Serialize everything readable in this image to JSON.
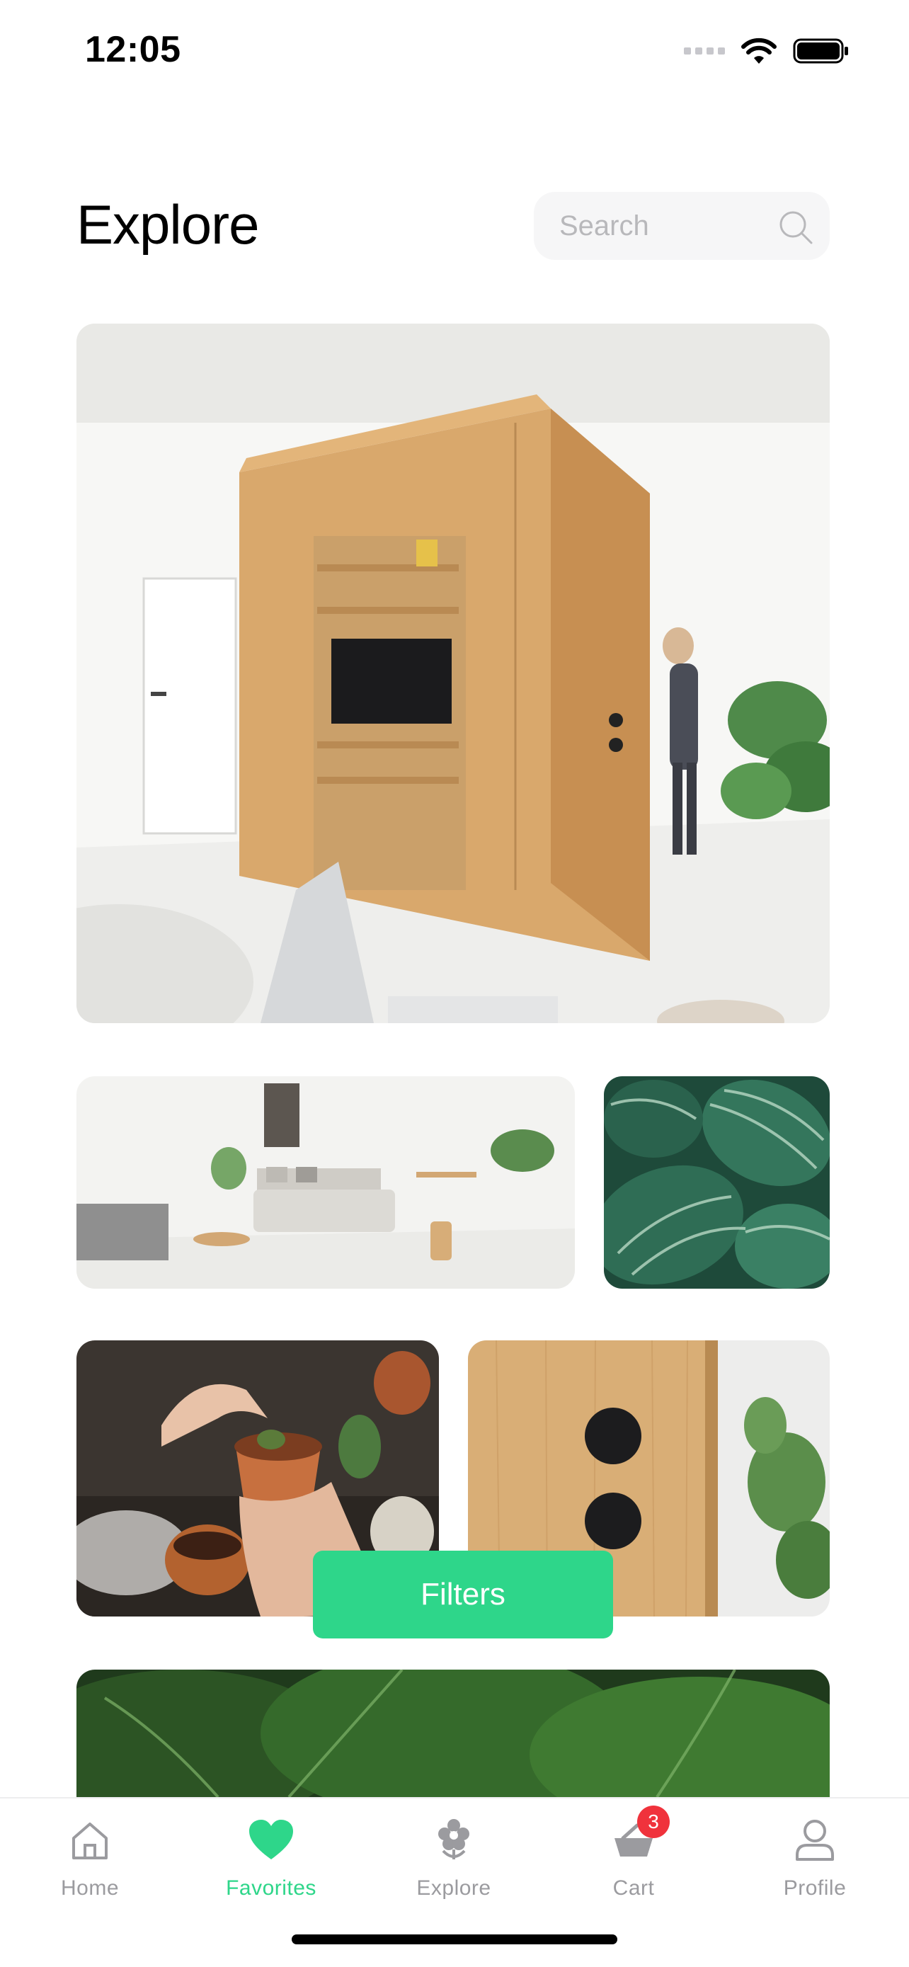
{
  "status_bar": {
    "time": "12:05"
  },
  "header": {
    "title": "Explore",
    "search_placeholder": "Search"
  },
  "gallery": {
    "images": [
      "Wooden cabinet room divider",
      "Bright bedroom with plants",
      "Striped calathea leaves",
      "Hands potting a cactus",
      "Wooden cabinet with black knobs",
      "Monstera leaves"
    ]
  },
  "filters_button": {
    "label": "Filters"
  },
  "tab_bar": {
    "tabs": [
      {
        "label": "Home",
        "icon": "home-icon",
        "active": false
      },
      {
        "label": "Favorites",
        "icon": "heart-icon",
        "active": true
      },
      {
        "label": "Explore",
        "icon": "flower-icon",
        "active": false
      },
      {
        "label": "Cart",
        "icon": "cart-icon",
        "active": false,
        "badge": "3"
      },
      {
        "label": "Profile",
        "icon": "profile-icon",
        "active": false
      }
    ]
  },
  "colors": {
    "accent": "#2ED68A",
    "badge": "#F0323C",
    "inactive": "#9B9B9F"
  }
}
